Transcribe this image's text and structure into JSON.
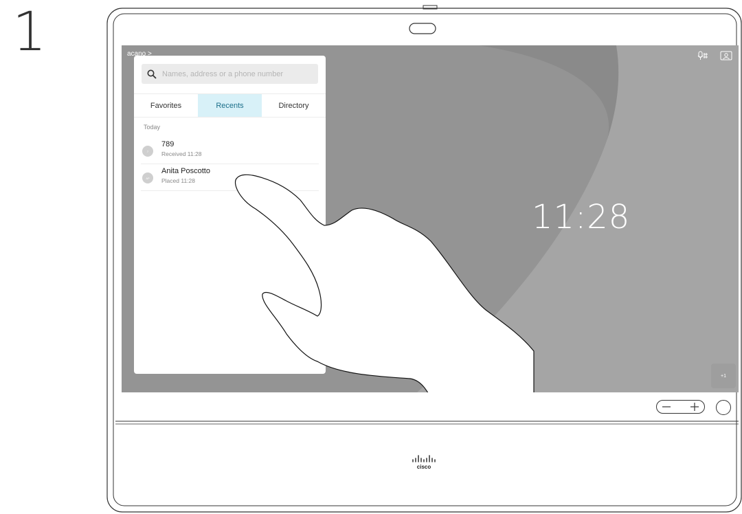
{
  "step_number": "1",
  "breadcrumb": "acano >",
  "search": {
    "placeholder": "Names, address or a phone number"
  },
  "tabs": [
    "Favorites",
    "Recents",
    "Directory"
  ],
  "active_tab": "Recents",
  "recents": {
    "section_label": "Today",
    "items": [
      {
        "initials": "7",
        "name": "789",
        "detail": "Received 11:28"
      },
      {
        "initials": "AP",
        "name": "Anita Poscotto",
        "detail": "Placed 11:28"
      }
    ]
  },
  "clock": "11:28",
  "badge": "+1",
  "top_icons": [
    "mic-mute-icon",
    "self-view-icon"
  ],
  "brand": "cisco"
}
